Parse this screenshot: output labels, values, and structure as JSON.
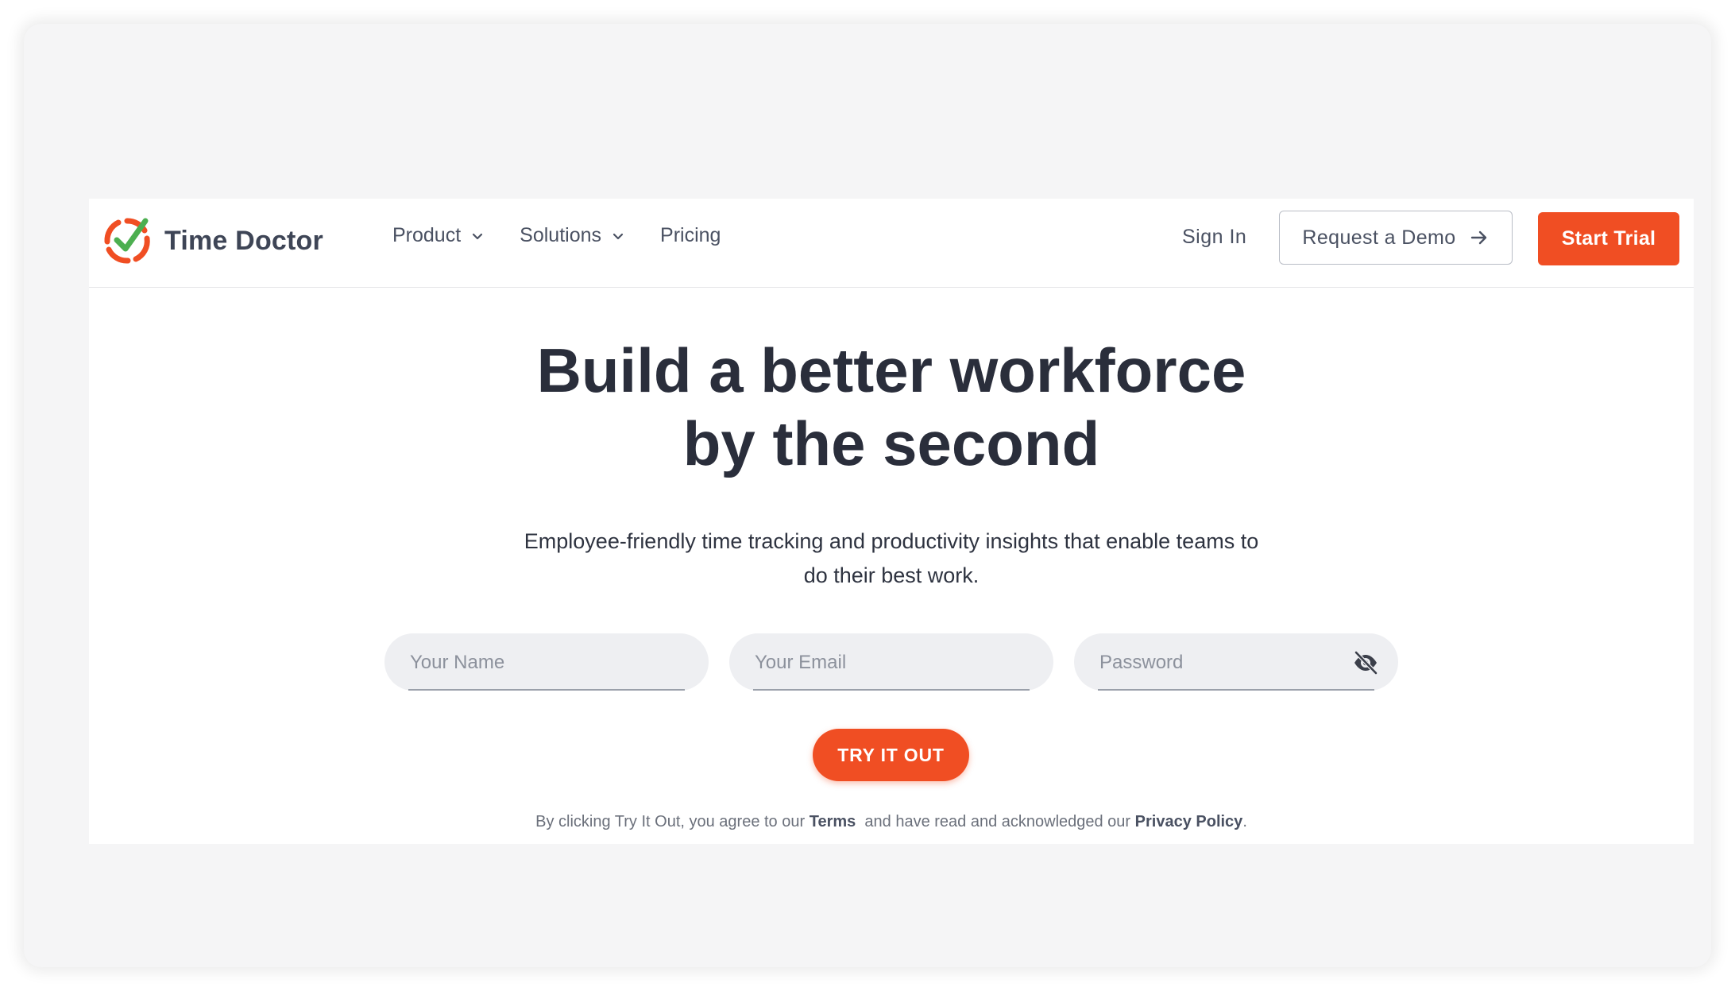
{
  "brand": {
    "name": "Time Doctor",
    "accent_color": "#f04e23",
    "check_color": "#4caf50"
  },
  "nav": {
    "items": [
      {
        "label": "Product",
        "icon": "chevron-down-icon"
      },
      {
        "label": "Solutions",
        "icon": "chevron-down-icon"
      },
      {
        "label": "Pricing"
      }
    ],
    "sign_in": "Sign In",
    "request_demo": "Request a Demo",
    "request_demo_icon": "arrow-right-icon",
    "start_trial": "Start Trial"
  },
  "hero": {
    "title_line1": "Build a better workforce",
    "title_line2": "by the second",
    "subtitle": "Employee-friendly time tracking and productivity insights that enable teams to do their best work."
  },
  "form": {
    "name_placeholder": "Your Name",
    "email_placeholder": "Your Email",
    "password_placeholder": "Password",
    "password_icon": "eye-off-icon",
    "submit_label": "TRY IT OUT"
  },
  "legal": {
    "prefix": "By clicking Try It Out, you agree to our",
    "terms": "Terms",
    "middle": "and have read and acknowledged our",
    "privacy": "Privacy Policy",
    "suffix": "."
  }
}
